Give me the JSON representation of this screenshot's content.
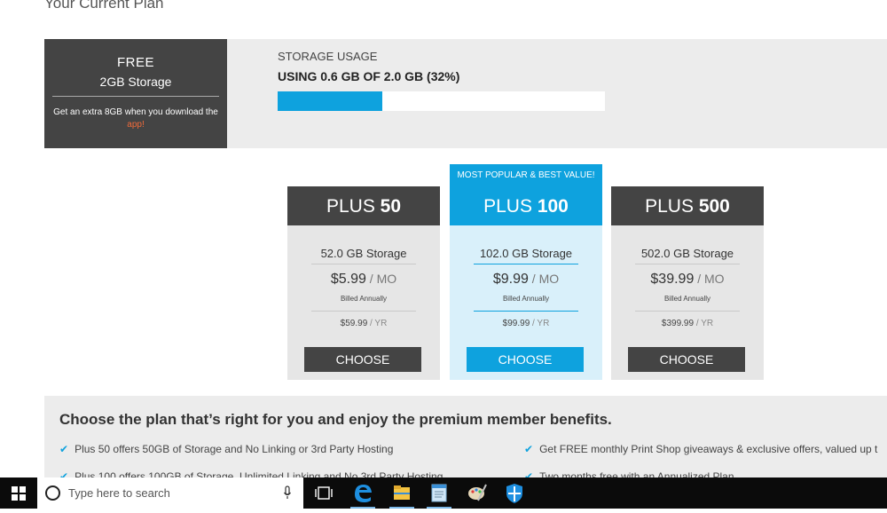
{
  "page": {
    "title": "Your Current Plan"
  },
  "current_plan": {
    "name": "FREE",
    "storage": "2GB Storage",
    "note_prefix": "Get an extra 8GB when you download the ",
    "note_link": "app!",
    "usage_label": "STORAGE USAGE",
    "usage_text": "USING 0.6 GB OF 2.0 GB (32%)",
    "usage_fraction": 0.32
  },
  "badge": "MOST POPULAR & BEST VALUE!",
  "plans": [
    {
      "prefix": "PLUS ",
      "size": "50",
      "storage": "52.0 GB Storage",
      "price": "$5.99",
      "price_unit": " / MO",
      "billed": "Billed Annually",
      "annual": "$59.99",
      "annual_unit": " / YR",
      "button": "CHOOSE"
    },
    {
      "prefix": "PLUS ",
      "size": "100",
      "storage": "102.0 GB Storage",
      "price": "$9.99",
      "price_unit": " / MO",
      "billed": "Billed Annually",
      "annual": "$99.99",
      "annual_unit": " / YR",
      "button": "CHOOSE"
    },
    {
      "prefix": "PLUS ",
      "size": "500",
      "storage": "502.0 GB Storage",
      "price": "$39.99",
      "price_unit": " / MO",
      "billed": "Billed Annually",
      "annual": "$399.99",
      "annual_unit": " / YR",
      "button": "CHOOSE"
    }
  ],
  "benefits": {
    "title": "Choose the plan that’s right for you and enjoy the premium member benefits.",
    "items": [
      "Plus 50 offers 50GB of Storage and No Linking or 3rd Party Hosting",
      "Get FREE monthly Print Shop giveaways & exclusive offers, valued up t",
      "Plus 100 offers 100GB of Storage, Unlimited Linking and No 3rd Party Hosting",
      "Two months free with an Annualized Plan"
    ]
  },
  "taskbar": {
    "search_placeholder": "Type here to search",
    "icons": [
      "windows-start-icon",
      "microphone-icon",
      "task-view-icon",
      "edge-browser-icon",
      "file-explorer-icon",
      "notepad-icon",
      "paint-icon",
      "security-shield-icon"
    ],
    "accent": "#0ea2de"
  }
}
